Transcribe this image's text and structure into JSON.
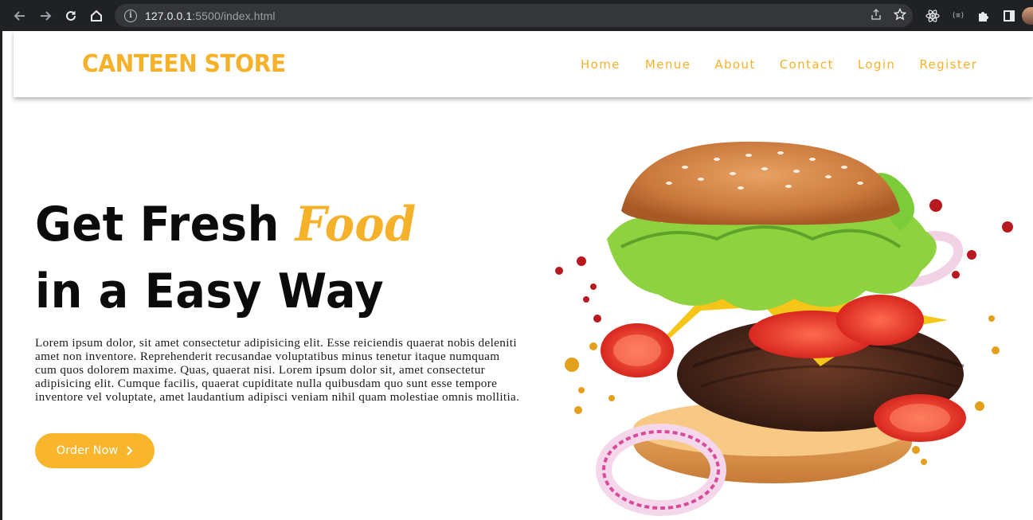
{
  "browser": {
    "url_host": "127.0.0.1",
    "url_rest": ":5500/index.html",
    "icons": [
      "back-arrow-icon",
      "forward-arrow-icon",
      "reload-icon",
      "home-icon",
      "site-info-icon",
      "share-icon",
      "bookmark-star-icon",
      "react-devtools-icon",
      "extension-icon",
      "puzzle-extensions-icon",
      "side-panel-icon",
      "profile-avatar"
    ]
  },
  "header": {
    "logo": "CANTEEN STORE",
    "nav": [
      "Home",
      "Menue",
      "About",
      "Contact",
      "Login",
      "Register"
    ]
  },
  "hero": {
    "title_part1": "Get Fresh ",
    "title_accent": "Food",
    "title_line2": "in a Easy Way",
    "body": "Lorem ipsum dolor, sit amet consectetur adipisicing elit. Esse reiciendis quaerat nobis deleniti amet non inventore. Reprehenderit recusandae voluptatibus minus tenetur itaque numquam cum quos dolorem maxime. Quas, quaerat nisi. Lorem ipsum dolor sit, amet consectetur adipisicing elit. Cumque facilis, quaerat cupiditate nulla quibusdam quo sunt esse tempore inventore vel voluptate, amet laudantium adipisci veniam nihil quam molestiae omnis mollitia.",
    "button_label": "Order Now",
    "button_icon": "chevron-right-icon",
    "image": "flying-burger-image"
  },
  "colors": {
    "accent": "#f6b12b",
    "button": "#f9b52c",
    "title": "#0b0b0b",
    "chrome": "#202124"
  }
}
